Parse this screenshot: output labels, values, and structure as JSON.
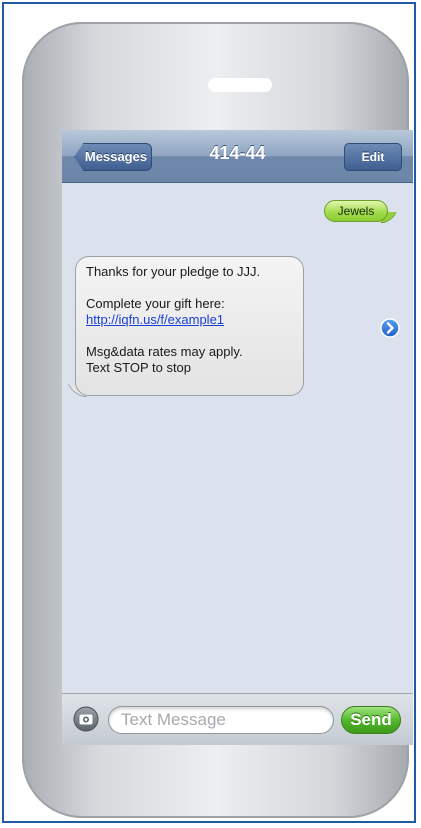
{
  "nav": {
    "back_label": "Messages",
    "title": "414-44",
    "edit_label": "Edit"
  },
  "messages": {
    "sent": "Jewels",
    "received": {
      "line1": "Thanks for your pledge to JJJ.",
      "line2": "Complete your gift here:",
      "link": "http://iqfn.us/f/example1",
      "line3": "Msg&data rates may apply.",
      "line4": "Text STOP to stop"
    }
  },
  "composer": {
    "placeholder": "Text Message",
    "send_label": "Send"
  },
  "icons": {
    "camera": "camera-icon",
    "detail": "chevron-right-circle-icon"
  },
  "colors": {
    "sent_bubble": "#a3dc4e",
    "send_button": "#4fb528",
    "link": "#1a3fd6",
    "nav_bar": "#8ea4c0"
  }
}
